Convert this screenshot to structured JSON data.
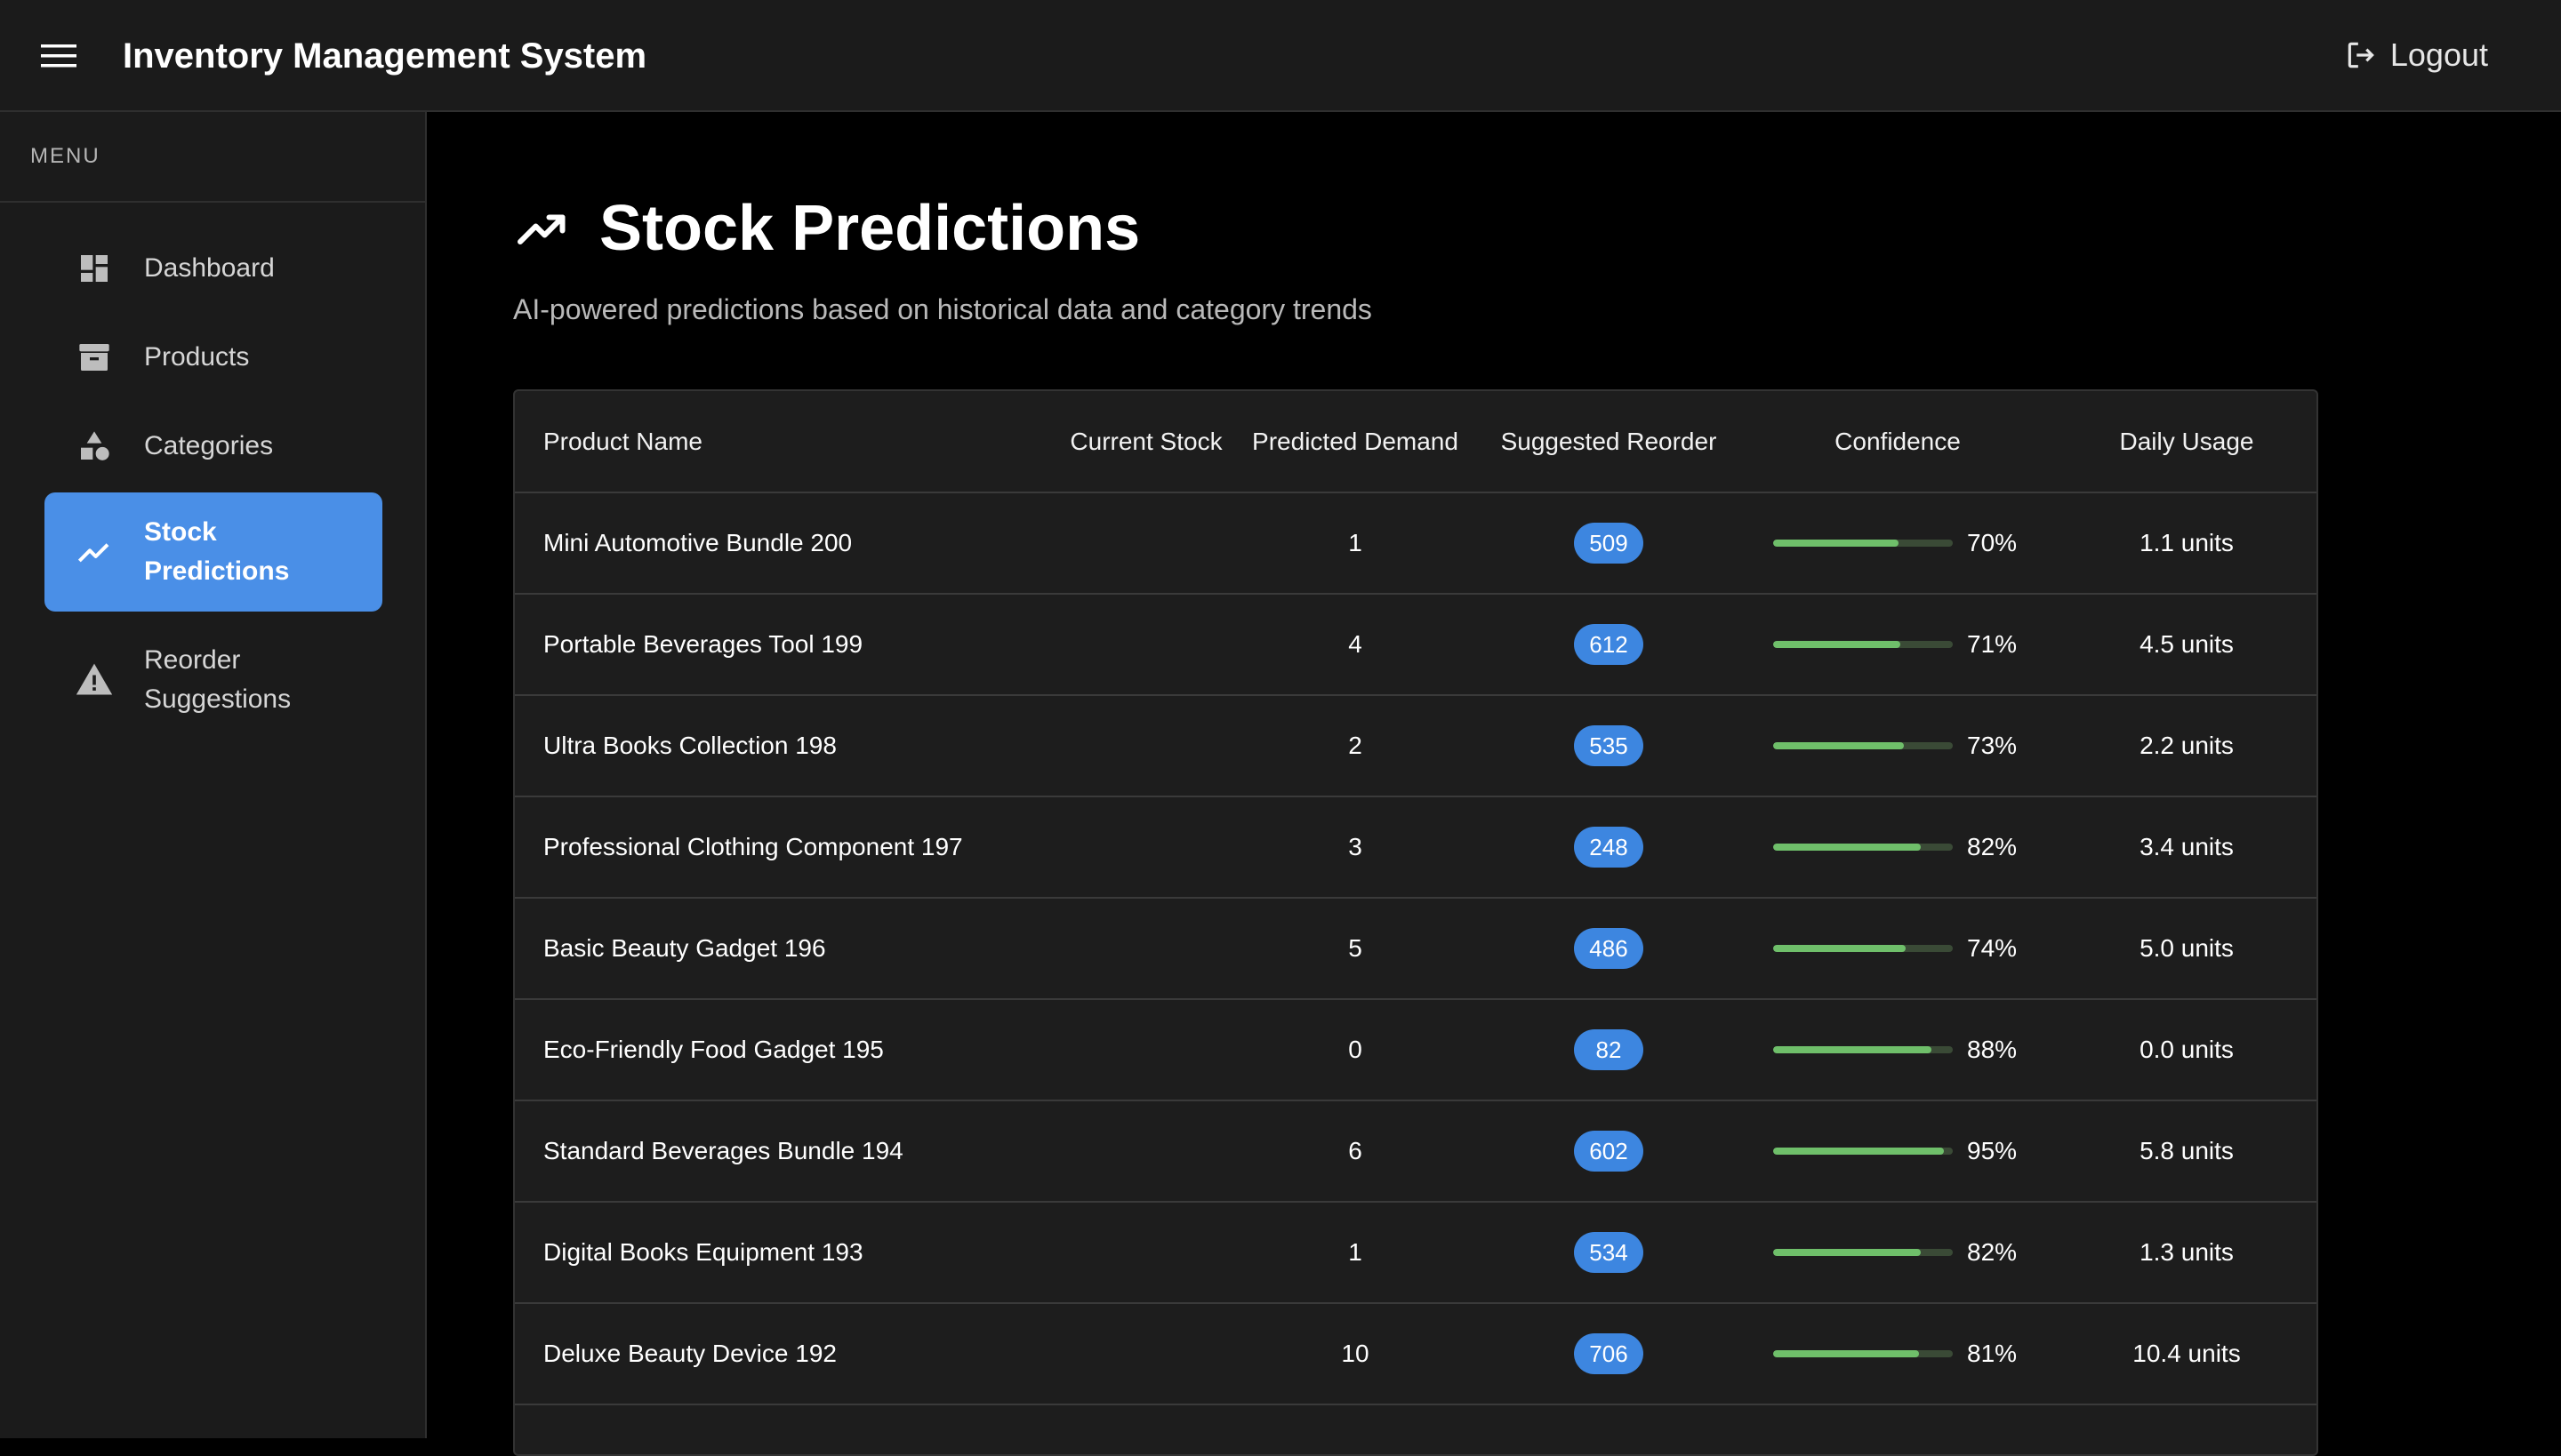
{
  "app": {
    "title": "Inventory Management System",
    "logout_label": "Logout"
  },
  "sidebar": {
    "header": "MENU",
    "items": [
      {
        "label": "Dashboard",
        "icon": "dashboard-icon",
        "active": false
      },
      {
        "label": "Products",
        "icon": "archive-box-icon",
        "active": false
      },
      {
        "label": "Categories",
        "icon": "shapes-icon",
        "active": false
      },
      {
        "label": "Stock Predictions",
        "icon": "trending-up-icon",
        "active": true
      },
      {
        "label": "Reorder Suggestions",
        "icon": "warning-icon",
        "active": false
      }
    ]
  },
  "page": {
    "title": "Stock Predictions",
    "subtitle": "AI-powered predictions based on historical data and category trends",
    "icon": "trending-up-icon"
  },
  "table": {
    "columns": [
      "Product Name",
      "Current Stock",
      "Predicted Demand",
      "Suggested Reorder",
      "Confidence",
      "Daily Usage"
    ],
    "rows": [
      {
        "name": "Mini Automotive Bundle 200",
        "stock": "",
        "demand": "1",
        "reorder": "509",
        "confidence": 0.7,
        "confidence_label": "70%",
        "usage": "1.1 units"
      },
      {
        "name": "Portable Beverages Tool 199",
        "stock": "",
        "demand": "4",
        "reorder": "612",
        "confidence": 0.71,
        "confidence_label": "71%",
        "usage": "4.5 units"
      },
      {
        "name": "Ultra Books Collection 198",
        "stock": "",
        "demand": "2",
        "reorder": "535",
        "confidence": 0.73,
        "confidence_label": "73%",
        "usage": "2.2 units"
      },
      {
        "name": "Professional Clothing Component 197",
        "stock": "",
        "demand": "3",
        "reorder": "248",
        "confidence": 0.82,
        "confidence_label": "82%",
        "usage": "3.4 units"
      },
      {
        "name": "Basic Beauty Gadget 196",
        "stock": "",
        "demand": "5",
        "reorder": "486",
        "confidence": 0.74,
        "confidence_label": "74%",
        "usage": "5.0 units"
      },
      {
        "name": "Eco-Friendly Food Gadget 195",
        "stock": "",
        "demand": "0",
        "reorder": "82",
        "confidence": 0.88,
        "confidence_label": "88%",
        "usage": "0.0 units"
      },
      {
        "name": "Standard Beverages Bundle 194",
        "stock": "",
        "demand": "6",
        "reorder": "602",
        "confidence": 0.95,
        "confidence_label": "95%",
        "usage": "5.8 units"
      },
      {
        "name": "Digital Books Equipment 193",
        "stock": "",
        "demand": "1",
        "reorder": "534",
        "confidence": 0.82,
        "confidence_label": "82%",
        "usage": "1.3 units"
      },
      {
        "name": "Deluxe Beauty Device 192",
        "stock": "",
        "demand": "10",
        "reorder": "706",
        "confidence": 0.81,
        "confidence_label": "81%",
        "usage": "10.4 units"
      }
    ]
  },
  "colors": {
    "accent": "#4a8fe7",
    "pill": "#3d86e0",
    "confidence_bar": "#6fbf6a",
    "confidence_track": "#3a4a36"
  }
}
